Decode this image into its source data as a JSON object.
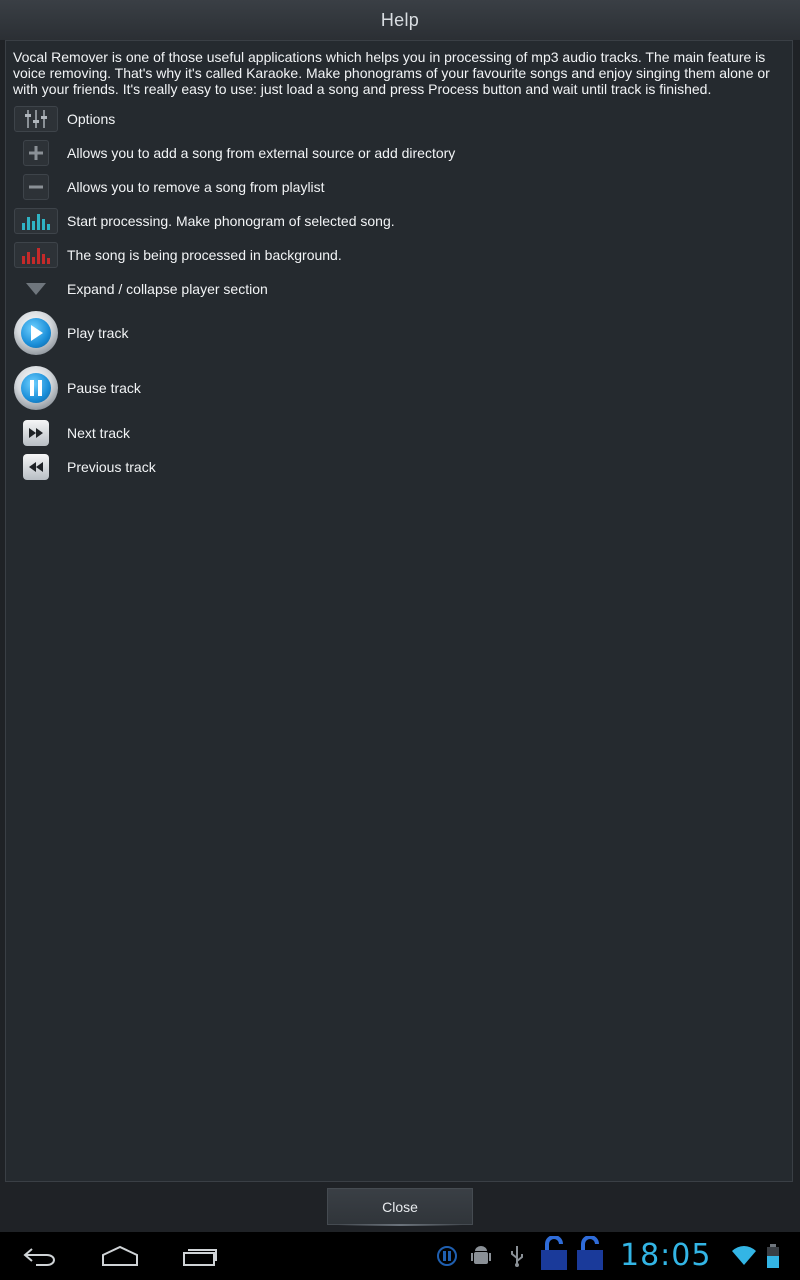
{
  "title": "Help",
  "intro": "Vocal Remover is one of those useful applications which helps you in processing of mp3 audio tracks. The main feature is voice removing. That's why it's called Karaoke. Make phonograms of your favourite songs and enjoy singing them alone or with your friends. It's really easy to use: just load a song and press Process button and wait until track is finished.",
  "items": [
    {
      "icon": "options-sliders-icon",
      "label": "Options"
    },
    {
      "icon": "add-icon",
      "label": "Allows you to add a song from external source or add directory"
    },
    {
      "icon": "remove-icon",
      "label": "Allows you to remove a song from playlist"
    },
    {
      "icon": "equalizer-green-icon",
      "label": "Start processing. Make phonogram of selected song."
    },
    {
      "icon": "equalizer-red-icon",
      "label": "The song is being processed in background."
    },
    {
      "icon": "triangle-down-icon",
      "label": "Expand / collapse player section"
    },
    {
      "icon": "play-icon",
      "label": "Play track"
    },
    {
      "icon": "pause-icon",
      "label": "Pause track"
    },
    {
      "icon": "next-icon",
      "label": "Next track"
    },
    {
      "icon": "previous-icon",
      "label": "Previous track"
    }
  ],
  "close_label": "Close",
  "status": {
    "time": "18:05"
  },
  "colors": {
    "accent": "#33b5e5",
    "background": "#252a2f"
  }
}
